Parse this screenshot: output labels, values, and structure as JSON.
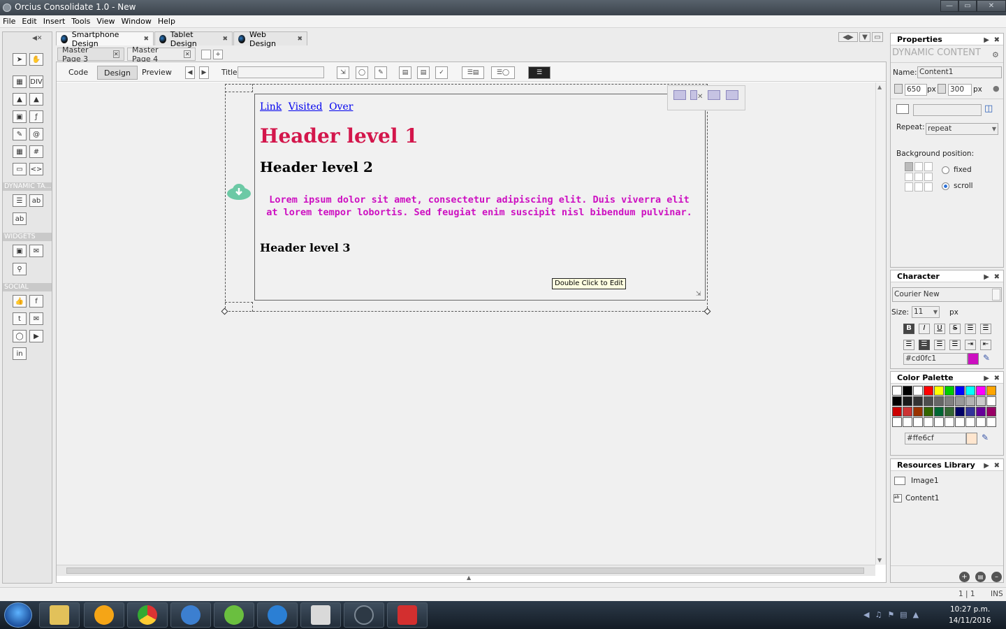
{
  "window": {
    "title": "Orcius Consolidate 1.0 - New"
  },
  "menu": [
    "File",
    "Edit",
    "Insert",
    "Tools",
    "View",
    "Window",
    "Help"
  ],
  "toolbox": {
    "sections": [
      "DYNAMIC TA...",
      "WIDGETS",
      "SOCIAL"
    ]
  },
  "design_tabs": [
    {
      "label": "Smartphone Design",
      "active": true
    },
    {
      "label": "Tablet Design",
      "active": false
    },
    {
      "label": "Web Design",
      "active": false
    }
  ],
  "master_tabs": [
    {
      "label": "Master Page 3",
      "active": false
    },
    {
      "label": "Master Page 4",
      "active": true
    }
  ],
  "view_modes": [
    "Code",
    "Design",
    "Preview"
  ],
  "active_view": "Design",
  "title_field": {
    "label": "Title:",
    "value": ""
  },
  "canvas": {
    "links": [
      "Link",
      "Visited",
      "Over"
    ],
    "h1": "Header level 1",
    "h2": "Header level 2",
    "paragraph": "Lorem ipsum dolor sit amet, consectetur adipiscing elit. Duis viverra elit at lorem tempor lobortis. Sed feugiat enim suscipit nisl bibendum pulvinar.",
    "h3": "Header level 3",
    "tooltip": "Double Click to Edit"
  },
  "properties": {
    "title": "Properties",
    "subtitle": "DYNAMIC CONTENT",
    "name_label": "Name:",
    "name_value": "Content1",
    "width": "650",
    "height": "300",
    "unit": "px",
    "repeat_label": "Repeat:",
    "repeat_value": "repeat",
    "bgpos_label": "Background position:",
    "fixed": "fixed",
    "scroll": "scroll",
    "selected_attachment": "scroll"
  },
  "character": {
    "title": "Character",
    "font": "Courier New",
    "size_label": "Size:",
    "size_value": "11",
    "unit": "px",
    "color_value": "#cd0fc1",
    "color": "#cd0fc1"
  },
  "palette": {
    "title": "Color Palette",
    "value": "#ffe6cf",
    "color": "#ffe6cf",
    "rows": [
      [
        "#ffffff",
        "#000000",
        "#ffffff",
        "#ff0000",
        "#ffff00",
        "#00cc00",
        "#0000ff",
        "#00ffff",
        "#ff00ff",
        "#ffa500"
      ],
      [
        "#000000",
        "#1a1a1a",
        "#333333",
        "#4d4d4d",
        "#666666",
        "#808080",
        "#999999",
        "#b3b3b3",
        "#cccccc",
        "#ffffff"
      ],
      [
        "#cc0000",
        "#cc3333",
        "#993300",
        "#336600",
        "#006633",
        "#336633",
        "#000066",
        "#333399",
        "#660099",
        "#990066"
      ],
      [
        "#ffffff",
        "#ffffff",
        "#ffffff",
        "#ffffff",
        "#ffffff",
        "#ffffff",
        "#ffffff",
        "#ffffff",
        "#ffffff",
        "#ffffff"
      ]
    ]
  },
  "resources": {
    "title": "Resources Library",
    "items": [
      "Image1",
      "Content1"
    ]
  },
  "status": {
    "position": "1 | 1",
    "mode": "INS"
  },
  "clock": {
    "time": "10:27 p.m.",
    "date": "14/11/2016"
  }
}
